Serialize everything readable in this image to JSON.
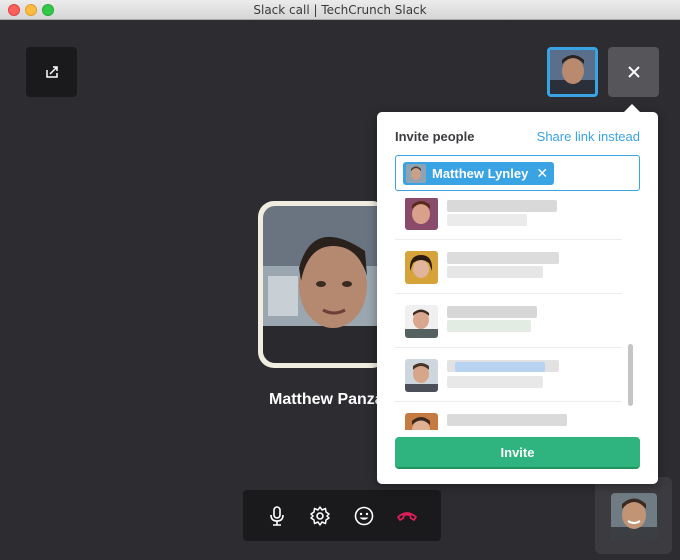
{
  "window": {
    "title": "Slack call | TechCrunch Slack"
  },
  "call": {
    "caller_name": "Matthew Panzarino",
    "share_icon": "share-screen-icon",
    "close_icon": "close-icon"
  },
  "controls": {
    "items": [
      {
        "icon": "microphone-icon"
      },
      {
        "icon": "gear-icon"
      },
      {
        "icon": "emoji-icon"
      },
      {
        "icon": "hang-up-icon",
        "color": "#e01e5a"
      }
    ]
  },
  "invite_panel": {
    "title": "Invite people",
    "share_link": "Share link instead",
    "selected_recipient": "Matthew Lynley",
    "remove_symbol": "✕",
    "invite_label": "Invite",
    "rows": 5
  },
  "colors": {
    "accent": "#3aa3e3",
    "invite": "#2fb37f",
    "background": "#2d2d31",
    "hangup": "#e01e5a"
  }
}
